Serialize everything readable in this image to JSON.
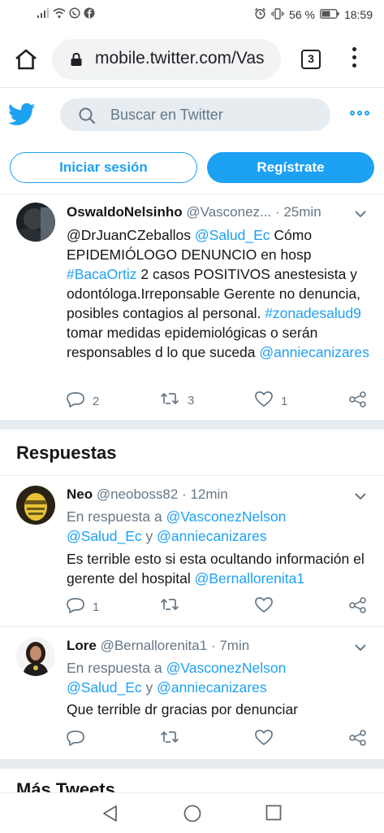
{
  "status_bar": {
    "battery": "56 %",
    "time": "18:59"
  },
  "browser": {
    "url": "mobile.twitter.com/Vas",
    "tab_count": "3"
  },
  "header": {
    "search_placeholder": "Buscar en Twitter"
  },
  "auth": {
    "login_label": "Iniciar sesión",
    "signup_label": "Regístrate"
  },
  "main_tweet": {
    "name": "OswaldoNelsinho",
    "handle": "@Vasconez...",
    "dot": "·",
    "time": "25min",
    "body": [
      {
        "t": "@DrJuanCZeballos",
        "link": false
      },
      {
        "t": " ",
        "link": false
      },
      {
        "t": "@Salud_Ec",
        "link": true
      },
      {
        "t": " Cómo EPIDEMIÓLOGO DENUNCIO en hosp ",
        "link": false
      },
      {
        "t": "#BacaOrtiz",
        "link": true
      },
      {
        "t": " 2 casos POSITIVOS  anestesista y odontóloga.Irreponsable Gerente no denuncia, posibles contagios al personal. ",
        "link": false
      },
      {
        "t": "#zonadesalud9",
        "link": true
      },
      {
        "t": " tomar medidas epidemiológicas o serán responsables d lo que suceda ",
        "link": false
      },
      {
        "t": "@anniecanizares",
        "link": true
      }
    ],
    "replies": "2",
    "retweets": "3",
    "likes": "1"
  },
  "responses_title": "Respuestas",
  "replies": [
    {
      "name": "Neo",
      "handle": "@neoboss82",
      "dot": "·",
      "time": "12min",
      "reply_prefix": "En respuesta a ",
      "reply_to_1": "@VasconezNelson",
      "reply_to_2": "@Salud_Ec",
      "reply_and": " y ",
      "reply_to_3": "@anniecanizares",
      "text": "Es terrible esto si esta ocultando información el gerente del hospital ",
      "text_mention": "@Bernallorenita1",
      "replies": "1",
      "retweets": "",
      "likes": ""
    },
    {
      "name": "Lore",
      "handle": "@Bernallorenita1",
      "dot": "·",
      "time": "7min",
      "reply_prefix": "En respuesta a ",
      "reply_to_1": "@VasconezNelson",
      "reply_to_2": "@Salud_Ec",
      "reply_and": " y ",
      "reply_to_3": "@anniecanizares",
      "text": "Que terrible dr gracias por denunciar",
      "text_mention": "",
      "replies": "",
      "retweets": "",
      "likes": ""
    }
  ],
  "more_tweets_title": "Más Tweets",
  "colors": {
    "accent": "#1da1f2",
    "muted": "#657786",
    "band": "#e6ecf0"
  }
}
